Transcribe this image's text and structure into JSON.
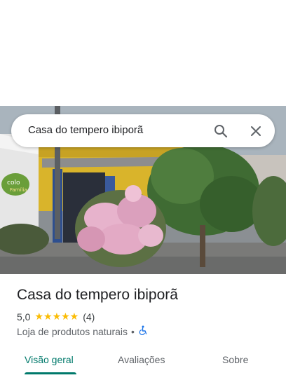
{
  "search": {
    "query": "Casa do tempero ibiporã"
  },
  "photo": {
    "sign_text": "colo",
    "sign_text_2": "Família"
  },
  "place": {
    "name": "Casa do tempero ibiporã",
    "rating": "5,0",
    "stars": "★★★★★",
    "reviews_count": "(4)",
    "category": "Loja de produtos naturais",
    "separator": "•"
  },
  "tabs": [
    {
      "label": "Visão geral",
      "active": true
    },
    {
      "label": "Avaliações",
      "active": false
    },
    {
      "label": "Sobre",
      "active": false
    }
  ],
  "colors": {
    "accent": "#00796b",
    "star": "#fbbc04"
  },
  "icons": [
    "search-icon",
    "close-icon",
    "wheelchair-icon"
  ]
}
